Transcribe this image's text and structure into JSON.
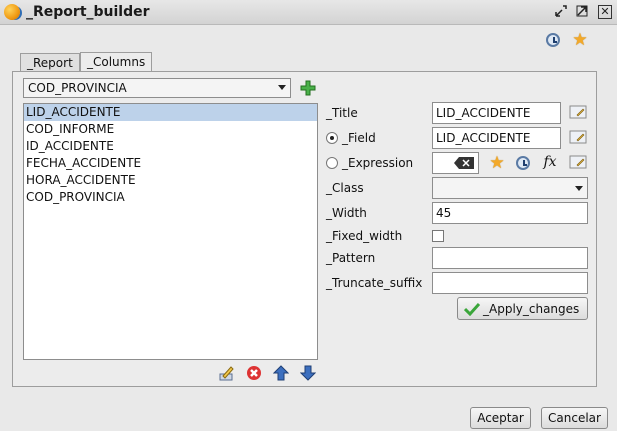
{
  "window": {
    "title": "_Report_builder"
  },
  "tabs": [
    {
      "label": "_Report"
    },
    {
      "label": "_Columns"
    }
  ],
  "columns": {
    "selector_value": "COD_PROVINCIA",
    "list_items": [
      "LID_ACCIDENTE",
      "COD_INFORME",
      "ID_ACCIDENTE",
      "FECHA_ACCIDENTE",
      "HORA_ACCIDENTE",
      "COD_PROVINCIA"
    ],
    "selected_index": 0
  },
  "form": {
    "title_label": "_Title",
    "title_value": "LID_ACCIDENTE",
    "field_label": "_Field",
    "field_value": "LID_ACCIDENTE",
    "expression_label": "_Expression",
    "class_label": "_Class",
    "class_value": "",
    "width_label": "_Width",
    "width_value": "45",
    "fixed_width_label": "_Fixed_width",
    "pattern_label": "_Pattern",
    "pattern_value": "",
    "truncate_suffix_label": "_Truncate_suffix",
    "truncate_suffix_value": "",
    "apply_label": "_Apply_changes",
    "fx_label": "fx"
  },
  "footer": {
    "accept_label": "Aceptar",
    "cancel_label": "Cancelar"
  },
  "icons": {
    "add": "plus-icon",
    "edit": "edit-icon",
    "delete": "delete-icon",
    "up": "arrow-up-icon",
    "down": "arrow-down-icon"
  },
  "colors": {
    "selection": "#bdd2ea",
    "accent_green": "#3aa63a",
    "star": "#f3a92a",
    "arrow_blue": "#3c6fbf"
  }
}
